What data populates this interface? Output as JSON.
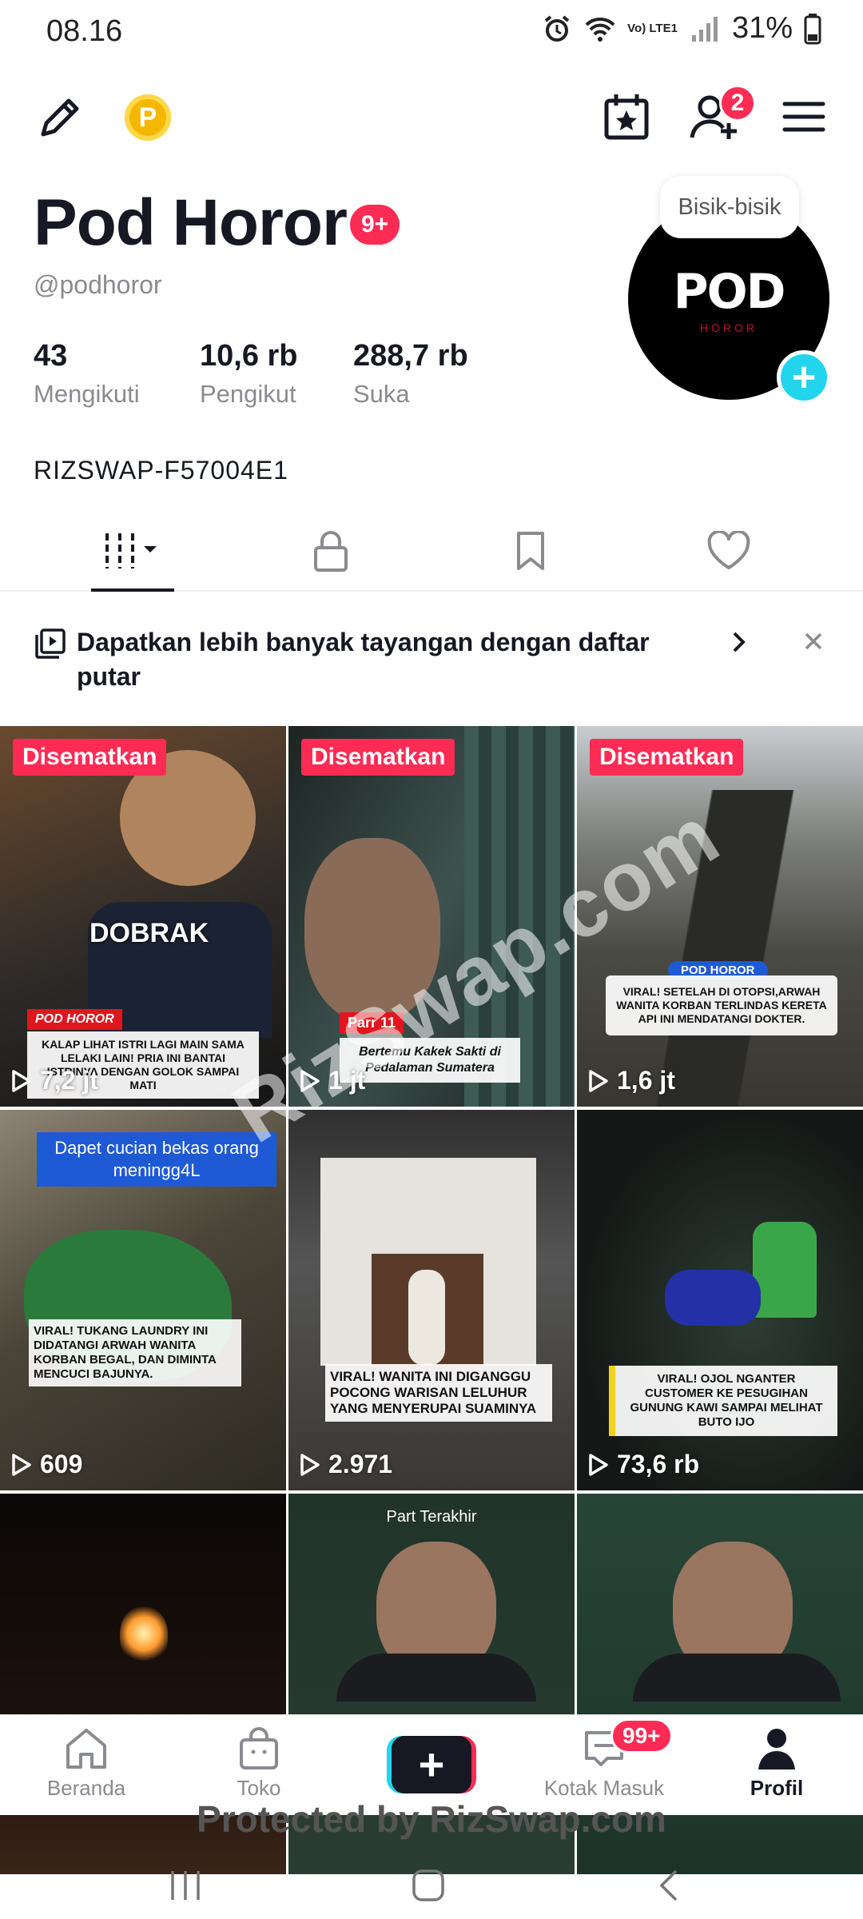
{
  "status_bar": {
    "time": "08.16",
    "network": "Vo) LTE1",
    "battery": "31%"
  },
  "profile": {
    "name": "Pod Horor",
    "name_badge": "9+",
    "handle": "@podhoror",
    "avatar_text": "POD",
    "avatar_subtext": "HOROR",
    "bubble_text": "Bisik-bisik",
    "bio": "RIZSWAP-F57004E1",
    "stats": [
      {
        "value": "43",
        "label": "Mengikuti"
      },
      {
        "value": "10,6 rb",
        "label": "Pengikut"
      },
      {
        "value": "288,7 rb",
        "label": "Suka"
      }
    ]
  },
  "top_bar": {
    "coin_label": "P",
    "friends_badge": "2"
  },
  "playlist_banner": {
    "text": "Dapatkan lebih banyak tayangan dengan daftar putar"
  },
  "grid": {
    "tiles": [
      {
        "pinned": "Disematkan",
        "views": "7,2 jt",
        "overlay": "DOBRAK",
        "tag": "POD HOROR",
        "caption": "KALAP LIHAT ISTRI LAGI MAIN SAMA LELAKI LAIN! PRIA INI BANTAI ISTRINYA DENGAN GOLOK SAMPAI MATI",
        "bg": "#3b2e22"
      },
      {
        "pinned": "Disematkan",
        "views": "1 jt",
        "tag": "Parr 11",
        "caption": "Bertemu Kakek Sakti di Pedalaman Sumatera",
        "bg": "#2c3a38"
      },
      {
        "pinned": "Disematkan",
        "views": "1,6 jt",
        "tag": "POD HOROR",
        "caption": "VIRAL! SETELAH DI OTOPSI,ARWAH WANITA KORBAN TERLINDAS KERETA API INI MENDATANGI DOKTER.",
        "bg": "#5d615e"
      },
      {
        "views": "609",
        "headline": "Dapet cucian bekas orang meningg4L",
        "caption": "VIRAL! TUKANG LAUNDRY INI DIDATANGI ARWAH WANITA KORBAN BEGAL, DAN DIMINTA MENCUCI BAJUNYA.",
        "bg": "#3c3a33"
      },
      {
        "views": "2.971",
        "caption": "VIRAL! WANITA INI DIGANGGU POCONG WARISAN LELUHUR YANG MENYERUPAI SUAMINYA",
        "bg": "#4a4642"
      },
      {
        "views": "73,6 rb",
        "caption": "VIRAL! OJOL NGANTER CUSTOMER KE PESUGIHAN GUNUNG KAWI SAMPAI MELIHAT BUTO IJO",
        "bg": "#1a1e1c"
      },
      {
        "bg": "#1b0f0a"
      },
      {
        "headline": "Part Terakhir",
        "bg": "#1f3127"
      },
      {
        "bg": "#233a30"
      }
    ]
  },
  "watermark": "RizSwap.com",
  "bottom_nav": {
    "items": [
      {
        "label": "Beranda"
      },
      {
        "label": "Toko"
      },
      {
        "label": "Kotak Masuk",
        "badge": "99+"
      },
      {
        "label": "Profil"
      }
    ],
    "protected_text": "Protected by RizSwap.com"
  },
  "colors": {
    "accent": "#fe2c55",
    "cyan": "#20d5ec",
    "text": "#161823",
    "muted": "#8a8b91"
  }
}
